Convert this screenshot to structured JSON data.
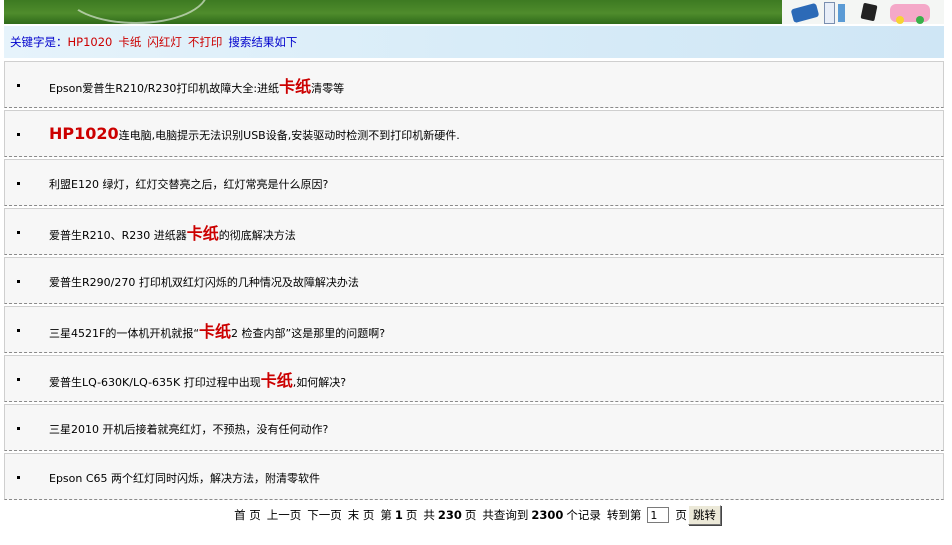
{
  "keyword_bar": {
    "label": "关键字是：",
    "terms": [
      "HP1020",
      "卡纸",
      "闪红灯",
      "不打印"
    ],
    "result_text": "搜索结果如下"
  },
  "results": [
    {
      "pre": "Epson爱普生R210/R230打印机故障大全:进纸",
      "hl": "卡纸",
      "post": "清零等"
    },
    {
      "pre": "",
      "hl": "HP1020",
      "post": "连电脑,电脑提示无法识别USB设备,安装驱动时检测不到打印机新硬件."
    },
    {
      "pre": "利盟E120 绿灯，红灯交替亮之后，红灯常亮是什么原因?",
      "hl": "",
      "post": ""
    },
    {
      "pre": "爱普生R210、R230 进纸器",
      "hl": "卡纸",
      "post": "的彻底解决方法"
    },
    {
      "pre": "爱普生R290/270 打印机双红灯闪烁的几种情况及故障解决办法",
      "hl": "",
      "post": ""
    },
    {
      "pre": "三星4521F的一体机开机就报“",
      "hl": "卡纸",
      "post": "2 检查内部”这是那里的问题啊?"
    },
    {
      "pre": "爱普生LQ-630K/LQ-635K 打印过程中出现",
      "hl": "卡纸",
      "post": ",如何解决?"
    },
    {
      "pre": "三星2010 开机后接着就亮红灯，不预热，没有任何动作?",
      "hl": "",
      "post": ""
    },
    {
      "pre": "Epson C65 两个红灯同时闪烁，解决方法，附清零软件",
      "hl": "",
      "post": ""
    }
  ],
  "pager": {
    "first": "首 页",
    "prev": "上一页",
    "next": "下一页",
    "last": "末 页",
    "page_prefix": "第",
    "page_current": "1",
    "page_suffix": "页",
    "total_prefix": "共",
    "total_pages": "230",
    "total_pages_suffix": "页",
    "records_prefix": "共查询到",
    "records": "2300",
    "records_suffix": "个记录",
    "jump_prefix": "转到第",
    "jump_value": "1",
    "jump_suffix": "页",
    "jump_button": "跳转"
  },
  "colors": {
    "keyword_label": "#0000cc",
    "keyword_term": "#cc0000",
    "highlight": "#cc0000"
  }
}
